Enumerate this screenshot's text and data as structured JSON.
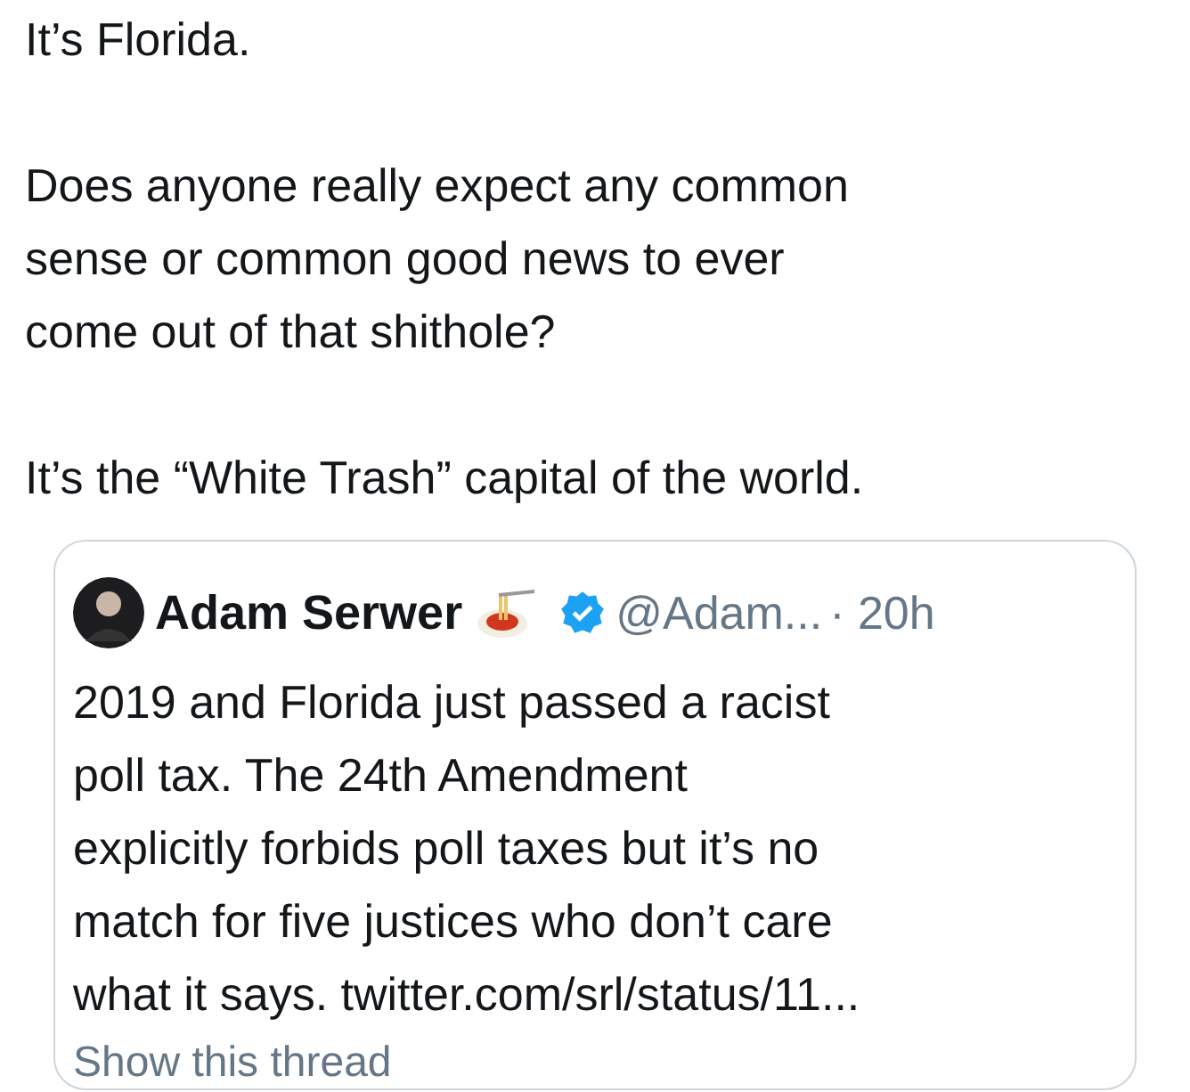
{
  "tweet": {
    "text": "It’s Florida.\n\nDoes anyone really expect any common\nsense or common good news to ever\ncome out of that shithole?\n\nIt’s the “White Trash” capital of the world."
  },
  "quoted_tweet": {
    "name": "Adam Serwer",
    "verified": true,
    "handle": "@Adam...",
    "time": "· 20h",
    "text": "2019 and Florida just passed a racist\npoll tax. The 24th Amendment\nexplicitly forbids poll taxes but it’s no\nmatch for five justices who don’t care\nwhat it says. twitter.com/srl/status/11...",
    "link": "Show this thread"
  }
}
